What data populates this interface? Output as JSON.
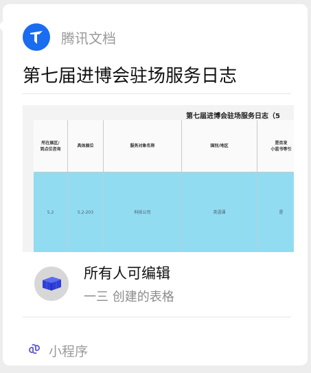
{
  "app": {
    "name": "腾讯文档",
    "icon": "tencent-docs-logo-icon",
    "brand_color": "#1a6cf0"
  },
  "document": {
    "title": "第七届进博会驻场服务日志"
  },
  "preview": {
    "sheet_title": "第七届进博会驻场服务日志（5",
    "columns": [
      {
        "line1": "所在展区/",
        "line2": "到点位咨询"
      },
      {
        "line1": "具体展位",
        "line2": ""
      },
      {
        "line1": "服务对象名称",
        "line2": ""
      },
      {
        "line1": "国别/地区",
        "line2": ""
      },
      {
        "line1": "是否发",
        "line2": "小蓝书等引"
      }
    ],
    "row": [
      "5.2",
      "5.2-203",
      "科技公司",
      "英语课",
      "是"
    ],
    "row_color": "#92dcf2"
  },
  "permission": {
    "icon": "spreadsheet-blocks-icon",
    "title": "所有人可编辑",
    "subtitle": "一三 创建的表格"
  },
  "footer": {
    "icon": "mini-program-link-icon",
    "label": "小程序"
  }
}
